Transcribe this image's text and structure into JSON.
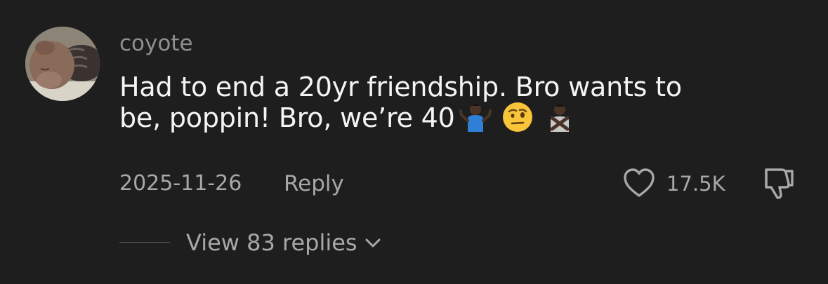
{
  "comment": {
    "username": "coyote",
    "text_line1": "Had to end a 20yr friendship. Bro wants to",
    "text_line2": "be, poppin! Bro, we’re 40",
    "emojis": [
      "person-shrugging-emoji",
      "face-with-raised-eyebrow-emoji",
      "person-gesturing-no-emoji"
    ],
    "date": "2025-11-26",
    "reply_label": "Reply",
    "like_count": "17.5K",
    "view_replies_label": "View 83 replies",
    "icons": {
      "like": "heart-outline-icon",
      "dislike": "thumbs-down-outline-icon",
      "expand": "chevron-down-icon"
    }
  },
  "colors": {
    "background": "#1e1e1e",
    "primary_text": "#f4f4f4",
    "secondary_text": "#a8a8a8"
  }
}
